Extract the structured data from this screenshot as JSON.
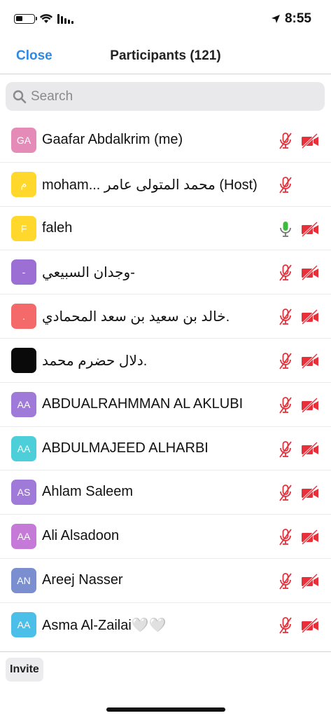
{
  "status_bar": {
    "time": "8:55"
  },
  "nav": {
    "close_label": "Close",
    "title": "Participants (121)"
  },
  "search": {
    "placeholder": "Search"
  },
  "participants": [
    {
      "initials": "GA",
      "name": "Gaafar Abdalkrim (me)",
      "avatar_color": "#e58bb7",
      "mic": "muted",
      "video": "off"
    },
    {
      "initials": "م",
      "name": "moham... محمد المتولى عامر  (Host)",
      "avatar_color": "#ffd82b",
      "mic": "muted",
      "video": "none"
    },
    {
      "initials": "F",
      "name": "faleh",
      "avatar_color": "#ffd82b",
      "mic": "active",
      "video": "off"
    },
    {
      "initials": "-",
      "name": "وجدان  السبيعي-",
      "avatar_color": "#9b6fd4",
      "mic": "muted",
      "video": "off"
    },
    {
      "initials": ".",
      "name": "خالد بن سعيد بن سعد المحمادي.",
      "avatar_color": "#f46a6a",
      "mic": "muted",
      "video": "off"
    },
    {
      "initials": "",
      "name": "دلال حضرم محمد.",
      "avatar_color": "#0a0a0a",
      "mic": "muted",
      "video": "off"
    },
    {
      "initials": "AA",
      "name": "ABDUALRAHMMAN AL AKLUBI",
      "avatar_color": "#a07ad8",
      "mic": "muted",
      "video": "off"
    },
    {
      "initials": "AA",
      "name": "ABDULMAJEED ALHARBI",
      "avatar_color": "#4ccfd8",
      "mic": "muted",
      "video": "off"
    },
    {
      "initials": "AS",
      "name": "Ahlam Saleem",
      "avatar_color": "#a07ad8",
      "mic": "muted",
      "video": "off"
    },
    {
      "initials": "AA",
      "name": "Ali Alsadoon",
      "avatar_color": "#c57ad8",
      "mic": "muted",
      "video": "off"
    },
    {
      "initials": "AN",
      "name": "Areej Nasser",
      "avatar_color": "#7b8fd0",
      "mic": "muted",
      "video": "off"
    },
    {
      "initials": "AA",
      "name": "Asma Al-Zailai🤍🤍",
      "avatar_color": "#4cbfe8",
      "mic": "muted",
      "video": "off"
    }
  ],
  "footer": {
    "invite_label": "Invite"
  },
  "colors": {
    "accent": "#2d8ae6",
    "muted_red": "#e8303a",
    "active_green": "#3dbb3d"
  }
}
